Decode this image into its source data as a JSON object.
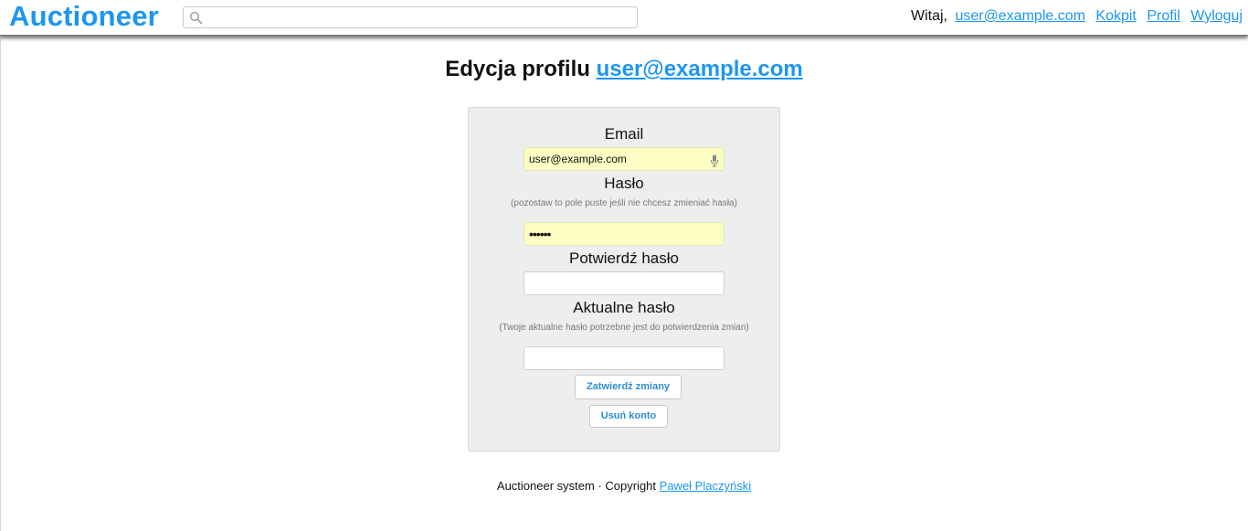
{
  "header": {
    "brand": "Auctioneer",
    "search": {
      "value": "",
      "placeholder": ""
    },
    "greeting": "Witaj,",
    "user_link": "user@example.com",
    "nav": {
      "dashboard": "Kokpit",
      "profile": "Profil",
      "logout": "Wyloguj"
    }
  },
  "page": {
    "title_prefix": "Edycja profilu",
    "title_user": "user@example.com"
  },
  "form": {
    "email_label": "Email",
    "email_value": "user@example.com",
    "password_label": "Hasło",
    "password_hint": "(pozostaw to pole puste jeśli nie chcesz zmieniać hasła)",
    "password_value": "••••••",
    "confirm_label": "Potwierdź hasło",
    "confirm_value": "",
    "current_label": "Aktualne hasło",
    "current_hint": "(Twoje aktualne hasło potrzebne jest do potwierdzenia zmian)",
    "current_value": "",
    "save_label": "Zatwierdź zmiany",
    "delete_label": "Usuń konto"
  },
  "footer": {
    "text": "Auctioneer system · Copyright",
    "author": "Paweł Placzyński"
  },
  "colors": {
    "brand": "#1e96f0",
    "autofill": "#fbfdc2",
    "panel": "#eeeeee"
  },
  "icons": {
    "search": "search-icon",
    "mic": "microphone-icon"
  }
}
